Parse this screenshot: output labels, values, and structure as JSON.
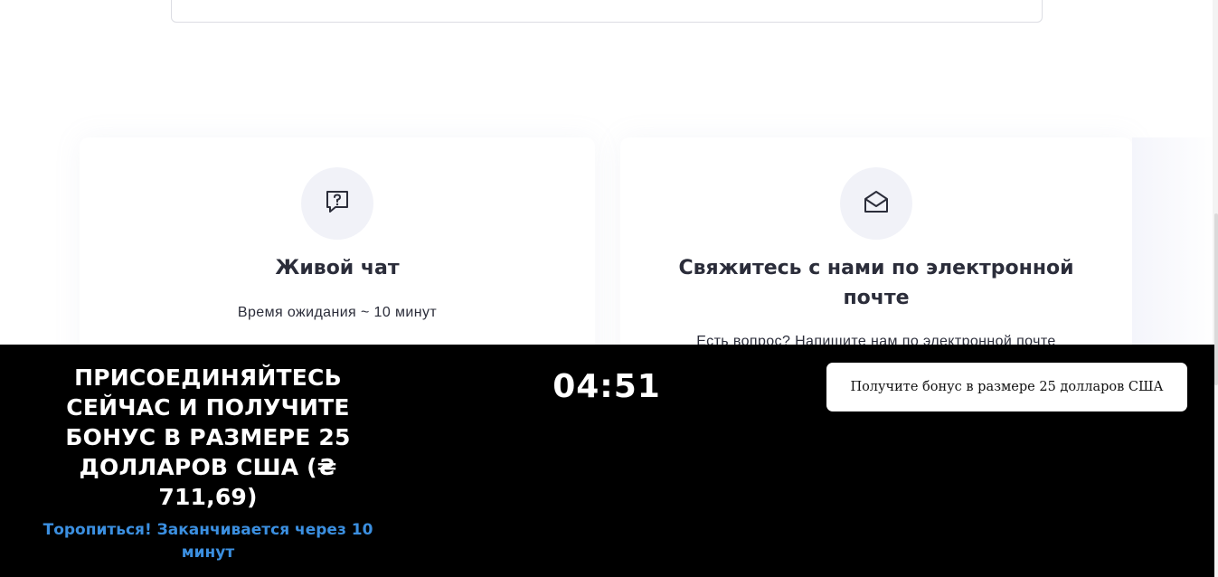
{
  "cards": [
    {
      "icon": "chat-question-icon",
      "title": "Живой чат",
      "text": "Время ожидания ~ 10 минут"
    },
    {
      "icon": "envelope-open-icon",
      "title": "Свяжитесь с нами по электронной почте",
      "text": "Есть вопрос? Напишите нам по электронной почте"
    }
  ],
  "promo": {
    "title": "ПРИСОЕДИНЯЙТЕСЬ СЕЙЧАС И ПОЛУЧИТЕ БОНУС В РАЗМЕРЕ 25 ДОЛЛАРОВ США (₴ 711,69)",
    "subtitle": "Торопиться! Заканчивается через 10 минут",
    "timer": "04:51",
    "button_label": "Получите бонус в размере 25 долларов США"
  },
  "colors": {
    "promo_background": "#000000",
    "promo_accent": "#3b8fe0",
    "icon_circle": "#f1f2f8"
  }
}
